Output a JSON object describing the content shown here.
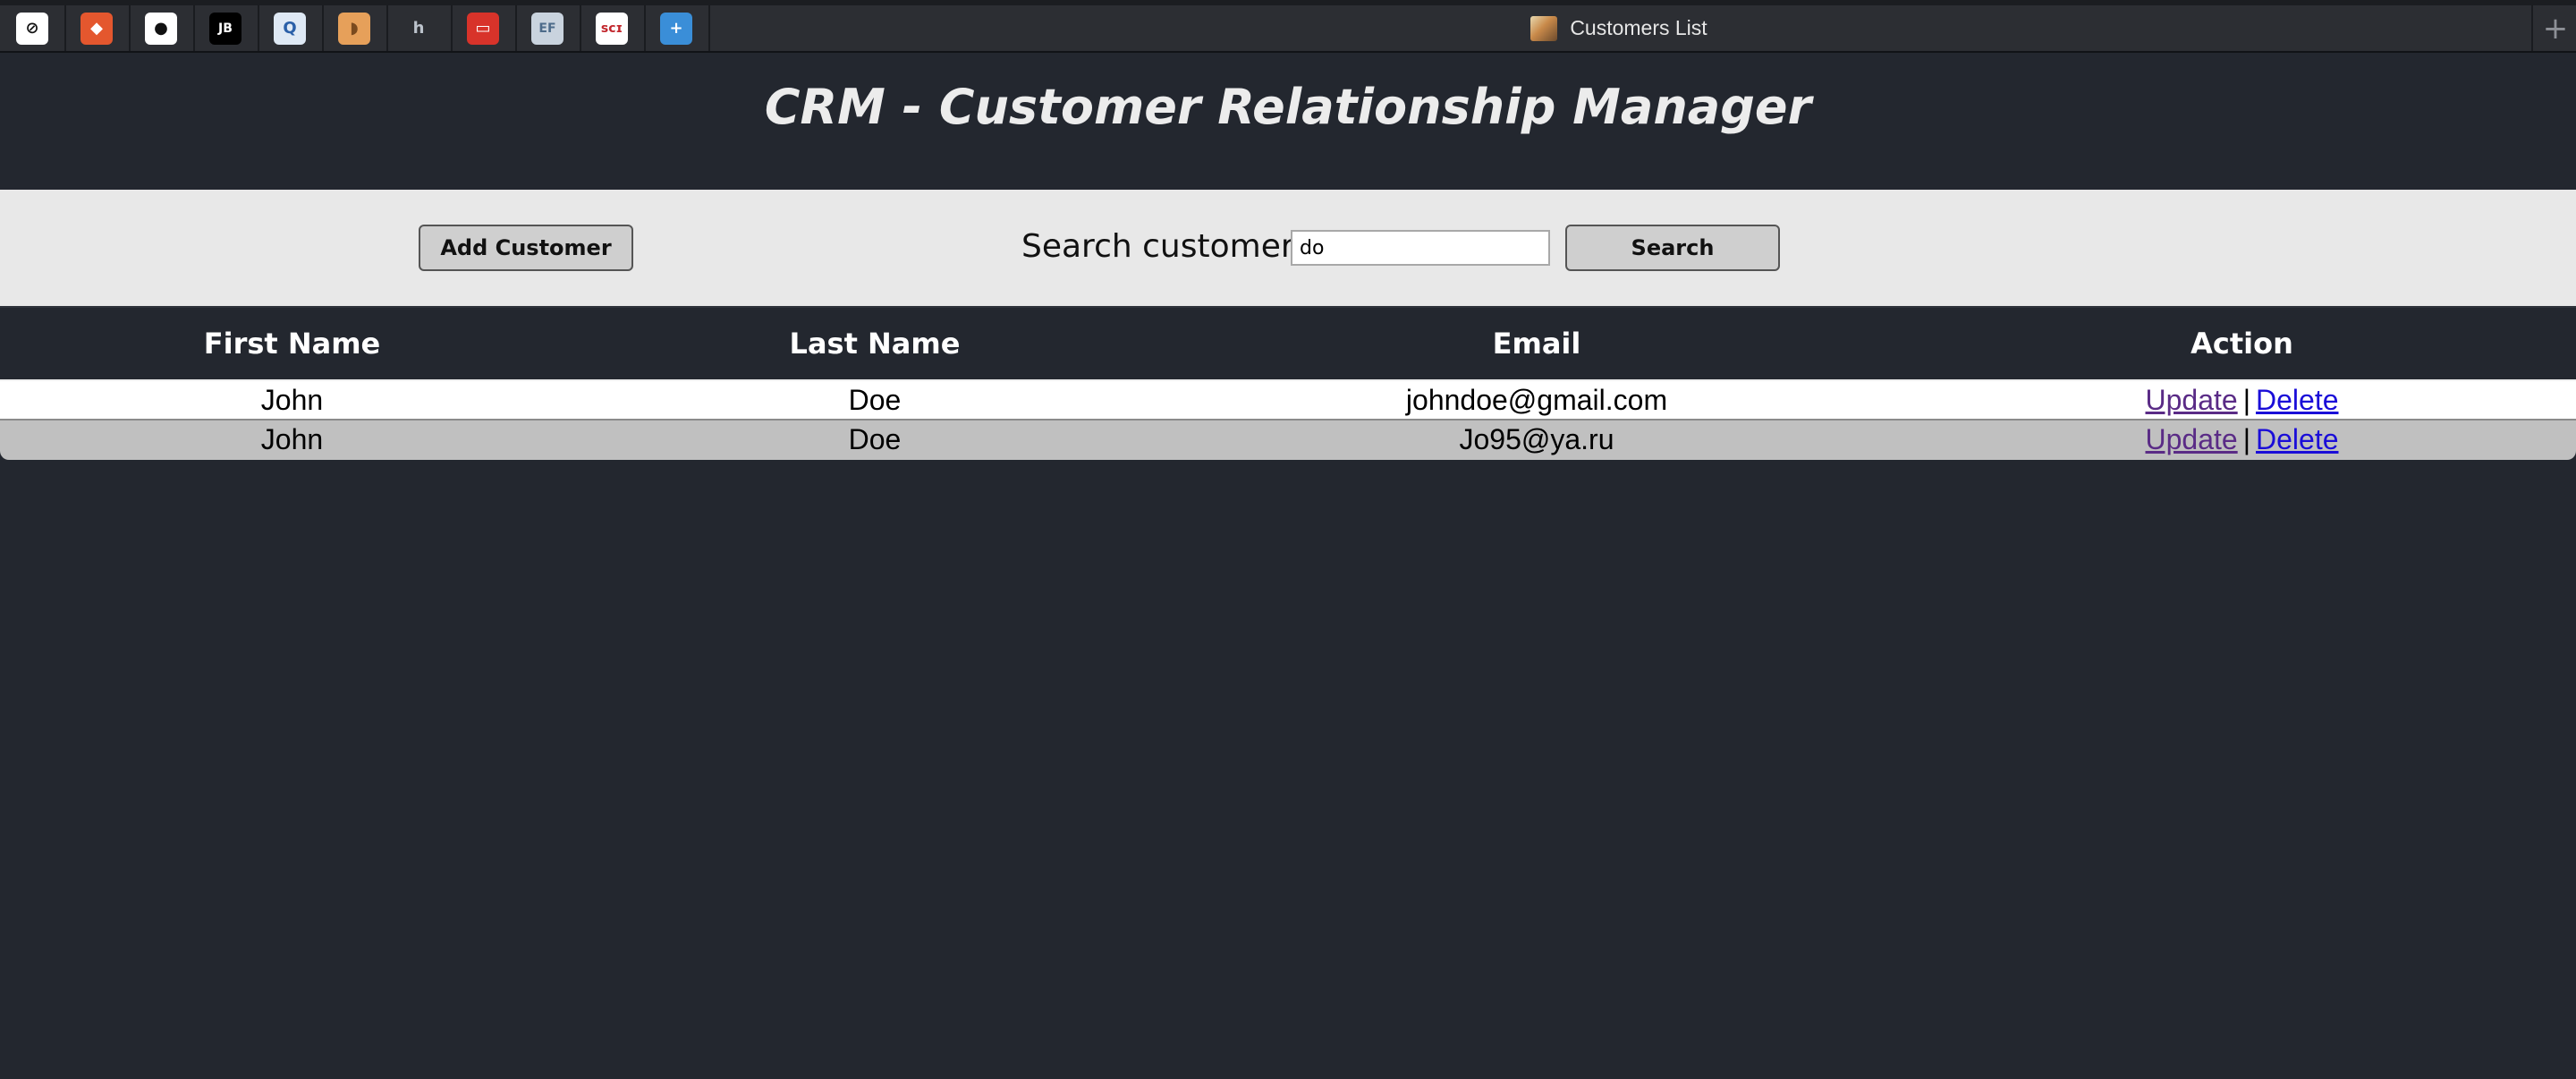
{
  "browser": {
    "pinned_tabs": [
      {
        "icon": "circle-slash-icon",
        "bg": "#ffffff",
        "fg": "#111111",
        "glyph": "⊘"
      },
      {
        "icon": "git-icon",
        "bg": "#e4572e",
        "fg": "#ffffff",
        "glyph": "◆"
      },
      {
        "icon": "github-icon",
        "bg": "#ffffff",
        "fg": "#111111",
        "glyph": "●"
      },
      {
        "icon": "jetbrains-icon",
        "bg": "#000000",
        "fg": "#ffffff",
        "glyph": "JB"
      },
      {
        "icon": "quicksearch-icon",
        "bg": "#dfe9f5",
        "fg": "#2a5fa8",
        "glyph": "Q"
      },
      {
        "icon": "bread-icon",
        "bg": "#e6a05a",
        "fg": "#7a4a1e",
        "glyph": "◗"
      },
      {
        "icon": "hibernate-icon",
        "bg": "#2c2e33",
        "fg": "#bcc3cc",
        "glyph": "h"
      },
      {
        "icon": "oracle-icon",
        "bg": "#d8332a",
        "fg": "#ffffff",
        "glyph": "▭"
      },
      {
        "icon": "ef-icon",
        "bg": "#c9d3de",
        "fg": "#4d6b8a",
        "glyph": "EF"
      },
      {
        "icon": "msci-icon",
        "bg": "#ffffff",
        "fg": "#c2272d",
        "glyph": "ꜱᴄɪ"
      },
      {
        "icon": "plus-square-icon",
        "bg": "#3a8ed8",
        "fg": "#ffffff",
        "glyph": "+"
      }
    ],
    "active_tab_title": "Customers List",
    "new_tab_glyph": "+"
  },
  "header": {
    "title": "CRM - Customer Relationship Manager"
  },
  "toolbar": {
    "add_label": "Add Customer",
    "search_label": "Search customer:",
    "search_value": "do",
    "search_button": "Search"
  },
  "table": {
    "headers": [
      "First Name",
      "Last Name",
      "Email",
      "Action"
    ],
    "rows": [
      {
        "first": "John",
        "last": "Doe",
        "email": "johndoe@gmail.com",
        "update": "Update",
        "sep": "|",
        "delete": "Delete"
      },
      {
        "first": "John",
        "last": "Doe",
        "email": "Jo95@ya.ru",
        "update": "Update",
        "sep": "|",
        "delete": "Delete"
      }
    ]
  }
}
